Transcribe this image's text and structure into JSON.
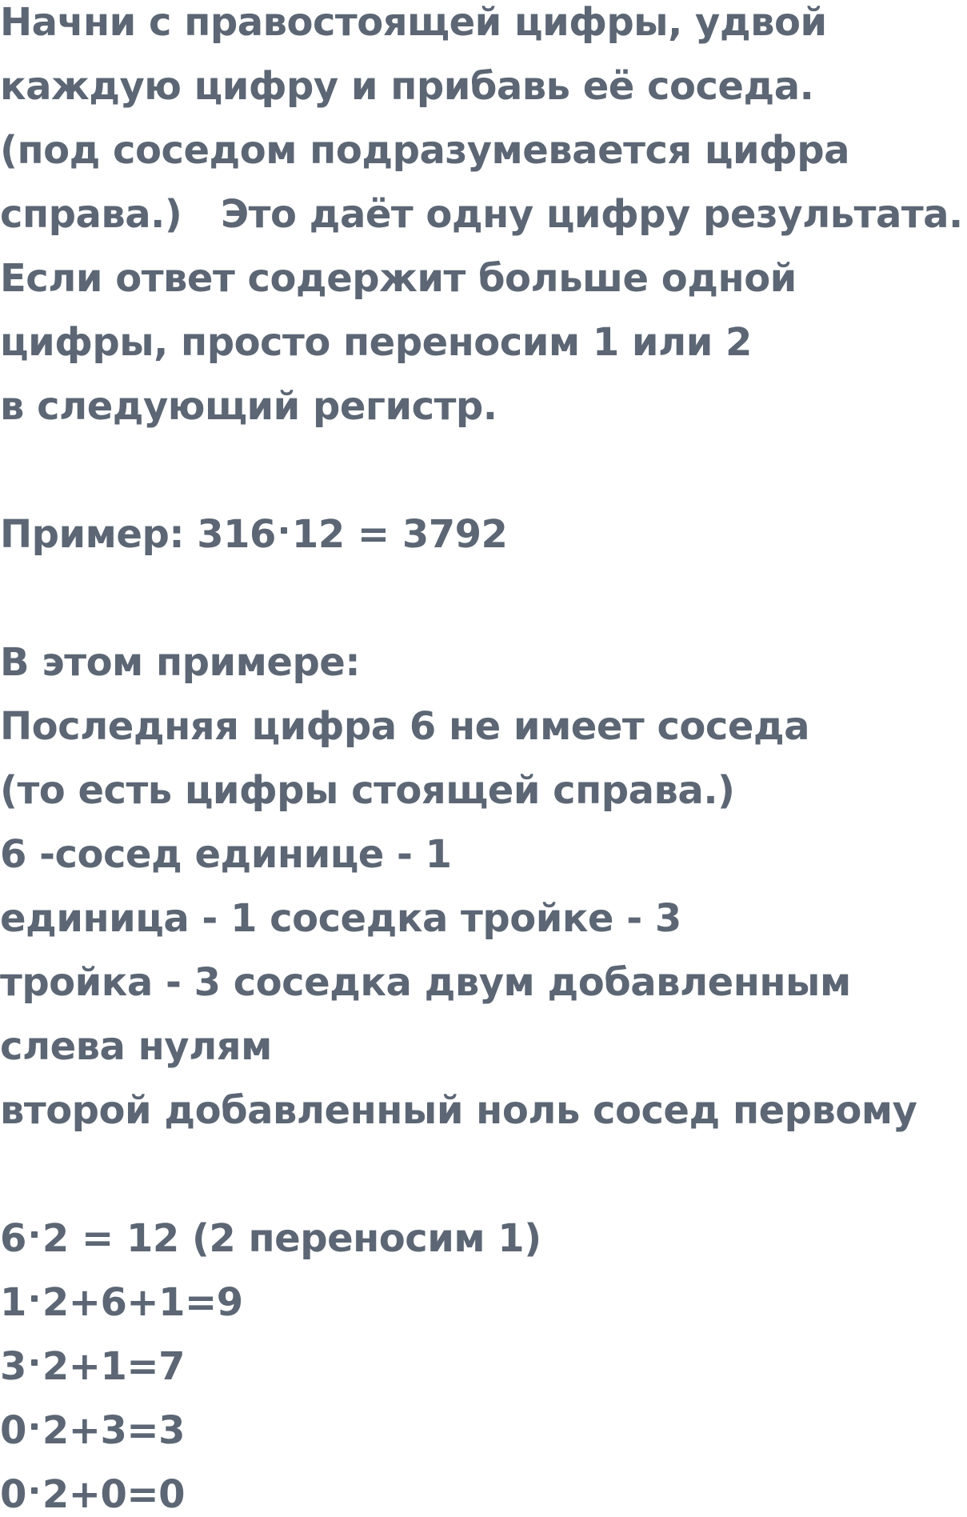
{
  "intro": {
    "line1": "Начни с правостоящей цифры, удвой",
    "line2": "каждую цифру и прибавь её соседа.",
    "line3": "(под соседом подразумевается цифра",
    "line4": "справа.)   Это даёт одну цифру результата.",
    "line5": "Если ответ содержит больше одной",
    "line6": "цифры, просто переносим 1 или 2",
    "line7": "в следующий регистр."
  },
  "example": {
    "label": "Пример: ",
    "a": "316",
    "b": "12 = 3792"
  },
  "explanation": {
    "heading": "В этом примере:",
    "line1": "Последняя цифра 6 не имеет соседа",
    "line2": "(то есть цифры стоящей справа.)",
    "line3": "6 -сосед единице - 1",
    "line4": "единица - 1 соседка тройке - 3",
    "line5": "тройка - 3 соседка двум добавленным",
    "line6": "слева нулям",
    "line7": "второй добавленный ноль сосед первому"
  },
  "steps": [
    {
      "left": "6",
      "right": "2 = 12 (2 переносим 1)"
    },
    {
      "left": "1",
      "right": "2+6+1=9"
    },
    {
      "left": "3",
      "right": "2+1=7"
    },
    {
      "left": "0",
      "right": "2+3=3"
    },
    {
      "left": "0",
      "right": "2+0=0"
    }
  ],
  "colors": {
    "text": "#5c6674",
    "background": "#ffffff"
  }
}
